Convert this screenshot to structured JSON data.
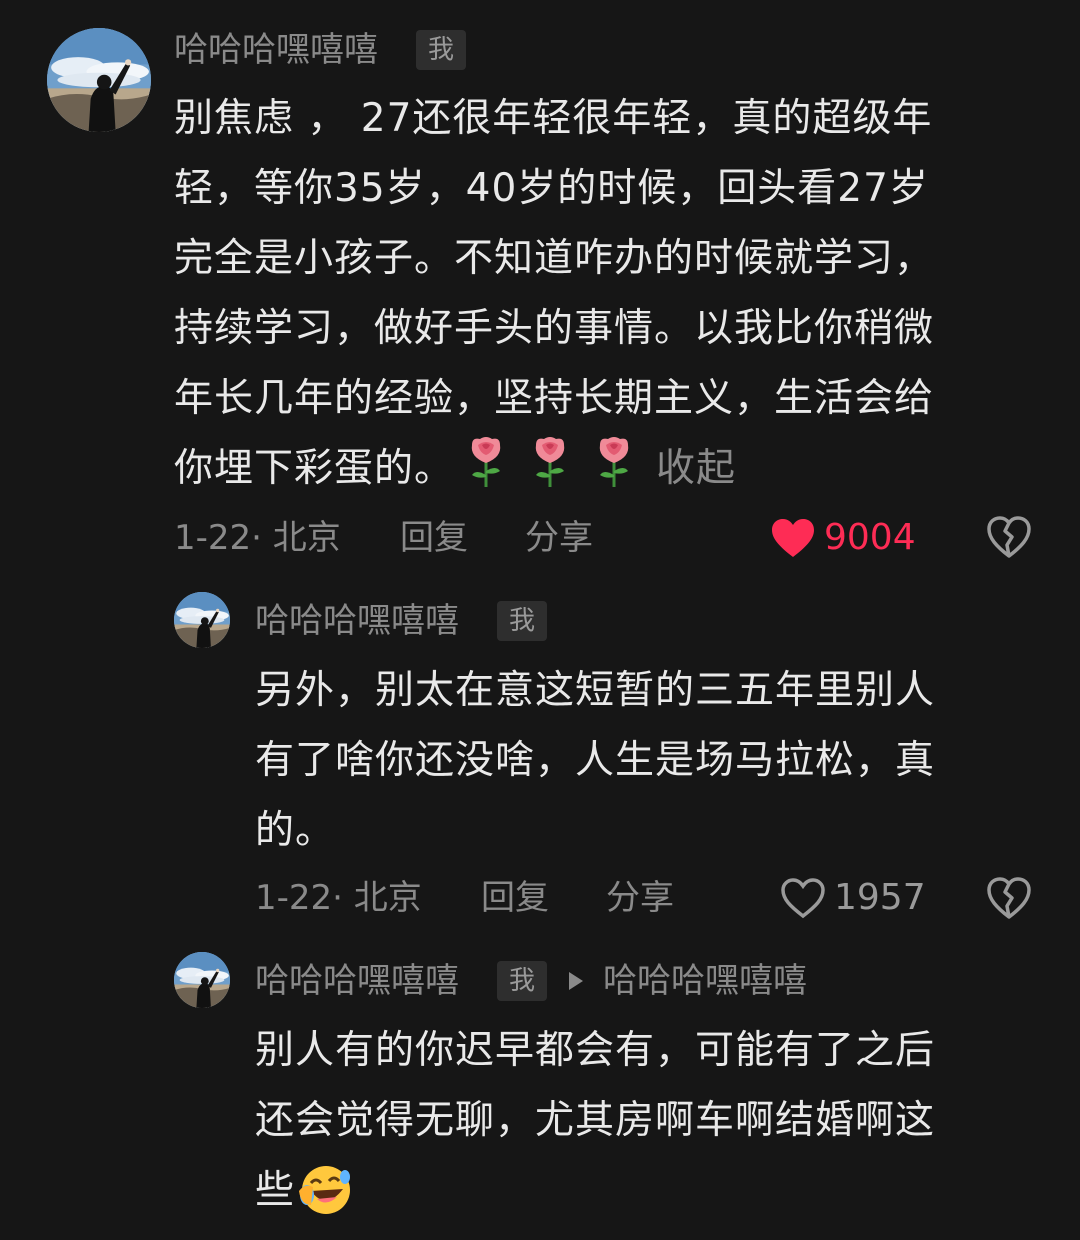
{
  "comments": [
    {
      "username": "哈哈哈嘿嘻嘻",
      "badge": "我",
      "lines": [
        "别焦虑 ， 27还很年轻很年轻，真的超级年",
        "轻，等你35岁，40岁的时候，回头看27岁",
        "完全是小孩子。不知道咋办的时候就学习，",
        "持续学习，做好手头的事情。以我比你稍微",
        "年长几年的经验，坚持长期主义，生活会给",
        "你埋下彩蛋的。"
      ],
      "collapse_label": "收起",
      "date_location": "1-22· 北京",
      "reply_label": "回复",
      "share_label": "分享",
      "like_count": "9004",
      "liked": true,
      "like_color": "#fe2c55"
    },
    {
      "username": "哈哈哈嘿嘻嘻",
      "badge": "我",
      "lines": [
        "另外，别太在意这短暂的三五年里别人",
        "有了啥你还没啥，人生是场马拉松，真",
        "的。"
      ],
      "date_location": "1-22· 北京",
      "reply_label": "回复",
      "share_label": "分享",
      "like_count": "1957",
      "liked": false
    },
    {
      "username": "哈哈哈嘿嘻嘻",
      "badge": "我",
      "reply_to": "哈哈哈嘿嘻嘻",
      "lines": [
        "别人有的你迟早都会有，可能有了之后",
        "还会觉得无聊，尤其房啊车啊结婚啊这",
        "些"
      ]
    }
  ]
}
